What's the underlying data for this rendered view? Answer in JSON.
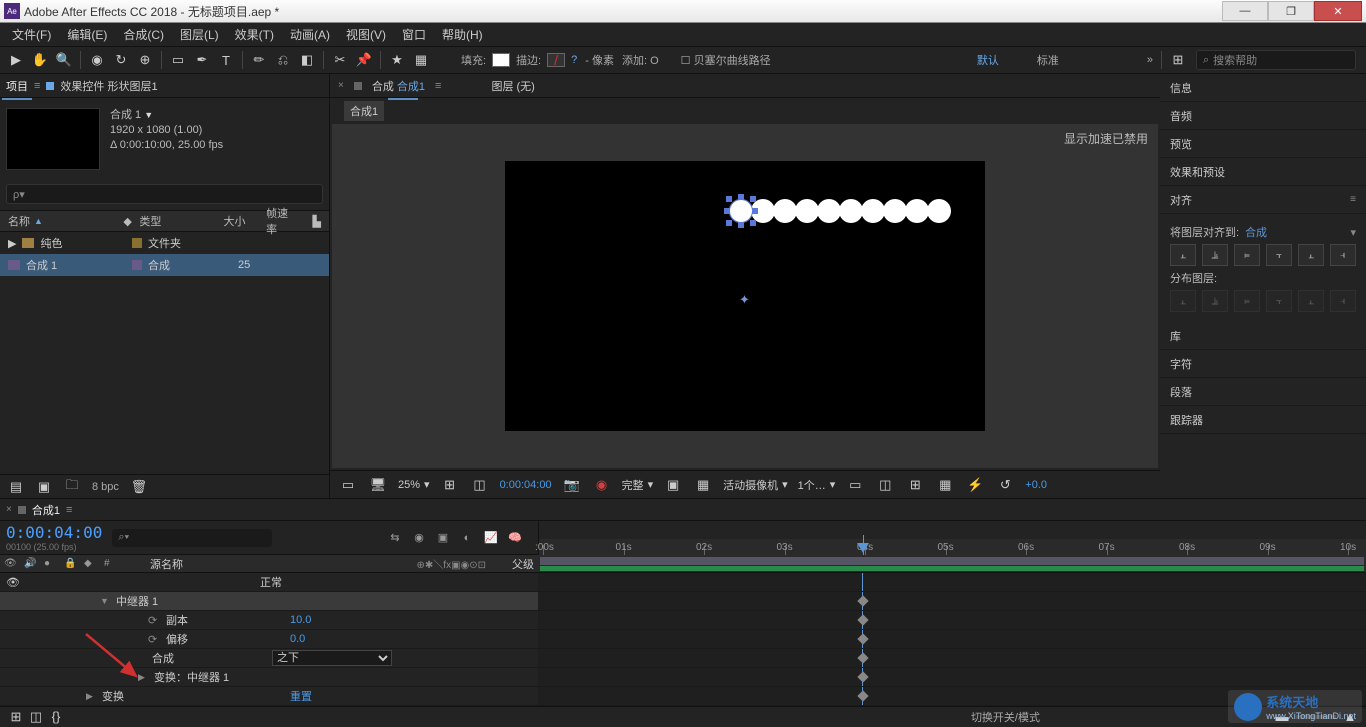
{
  "window": {
    "title": "Adobe After Effects CC 2018 - 无标题项目.aep *"
  },
  "menu": [
    "文件(F)",
    "编辑(E)",
    "合成(C)",
    "图层(L)",
    "效果(T)",
    "动画(A)",
    "视图(V)",
    "窗口",
    "帮助(H)"
  ],
  "toolbar": {
    "fill_label": "填充:",
    "stroke_label": "描边:",
    "stroke_q": "?",
    "px_label": "- 像素",
    "add_label": "添加: O",
    "bezier": "贝塞尔曲线路径",
    "default": "默认",
    "standard": "标准",
    "search_ph": "搜索帮助"
  },
  "project": {
    "tab1": "项目",
    "tab2": "效果控件 形状图层1",
    "comp_name": "合成 1",
    "comp_dim": "1920 x 1080 (1.00)",
    "comp_dur": "Δ 0:00:10:00, 25.00 fps",
    "search_ph": "ρ▾",
    "cols": {
      "name": "名称",
      "type": "类型",
      "size": "大小",
      "fps": "帧速率"
    },
    "rows": [
      {
        "name": "纯色",
        "type": "文件夹",
        "size": "",
        "kind": "folder"
      },
      {
        "name": "合成 1",
        "type": "合成",
        "size": "25",
        "kind": "comp",
        "sel": true
      }
    ],
    "bpc": "8 bpc"
  },
  "viewer": {
    "tab_comp": "合成",
    "tab_active": "合成1",
    "layer_none": "图层 (无)",
    "sub_tab": "合成1",
    "accel": "显示加速已禁用",
    "footer": {
      "zoom": "25%",
      "time": "0:00:04:00",
      "res": "完整",
      "cam": "活动摄像机",
      "view": "1个…",
      "exp": "+0.0"
    }
  },
  "right": {
    "panels": [
      "信息",
      "音频",
      "预览",
      "效果和预设",
      "对齐"
    ],
    "align": {
      "label": "将图层对齐到:",
      "value": "合成",
      "dist": "分布图层:"
    },
    "panels2": [
      "库",
      "字符",
      "段落",
      "跟踪器"
    ]
  },
  "timeline": {
    "tab": "合成1",
    "timecode": "0:00:04:00",
    "time_sub": "00100 (25.00 fps)",
    "cols": {
      "src": "源名称",
      "parent": "父级"
    },
    "ticks": [
      ":00s",
      "01s",
      "02s",
      "03s",
      "04s",
      "05s",
      "06s",
      "07s",
      "08s",
      "09s",
      "10s"
    ],
    "rows": [
      {
        "label": "中继器 1",
        "indent": 100,
        "arrow": "▼",
        "bg": "#3a3a3a"
      },
      {
        "label": "副本",
        "indent": 148,
        "icon": "⟳",
        "val": "10.0"
      },
      {
        "label": "偏移",
        "indent": 148,
        "icon": "⟳",
        "val": "0.0"
      },
      {
        "label": "合成",
        "indent": 148,
        "sel": "之下"
      },
      {
        "label": "变换：中继器 1",
        "indent": 138,
        "arrow": "▶",
        "small": true
      },
      {
        "label": "变换",
        "indent": 86,
        "arrow": "▶",
        "val": "重置"
      }
    ],
    "normal": "正常",
    "toggle": "切换开关/模式"
  },
  "watermark": {
    "t1": "系统天地",
    "t2": "www.XiTongTianDi.net"
  }
}
